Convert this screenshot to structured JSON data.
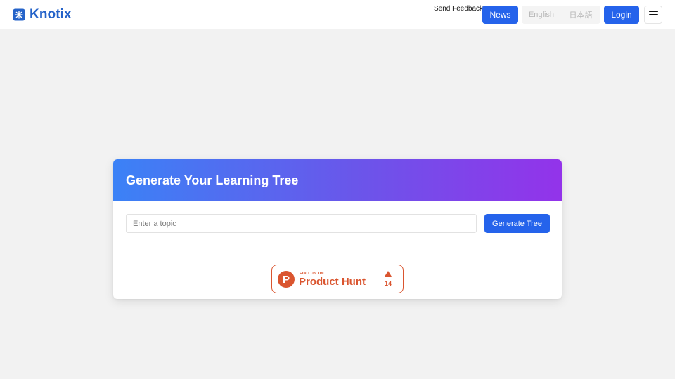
{
  "header": {
    "brand_name": "Knotix",
    "feedback_label": "Send Feedback",
    "news_label": "News",
    "languages": [
      "English",
      "日本語"
    ],
    "login_label": "Login"
  },
  "generator": {
    "title": "Generate Your Learning Tree",
    "input_value": "",
    "input_placeholder": "Enter a topic",
    "button_label": "Generate Tree"
  },
  "product_hunt": {
    "tagline": "FIND US ON",
    "name": "Product Hunt",
    "logo_letter": "P",
    "upvotes": "14"
  },
  "colors": {
    "brand": "#2563c9",
    "primary_button": "#2563eb",
    "gradient_start": "#3b82f6",
    "gradient_end": "#9333ea",
    "product_hunt": "#da552f"
  },
  "icons": {
    "brand": "knot-logo-icon",
    "menu": "hamburger-menu-icon",
    "upvote": "upvote-triangle-icon"
  }
}
